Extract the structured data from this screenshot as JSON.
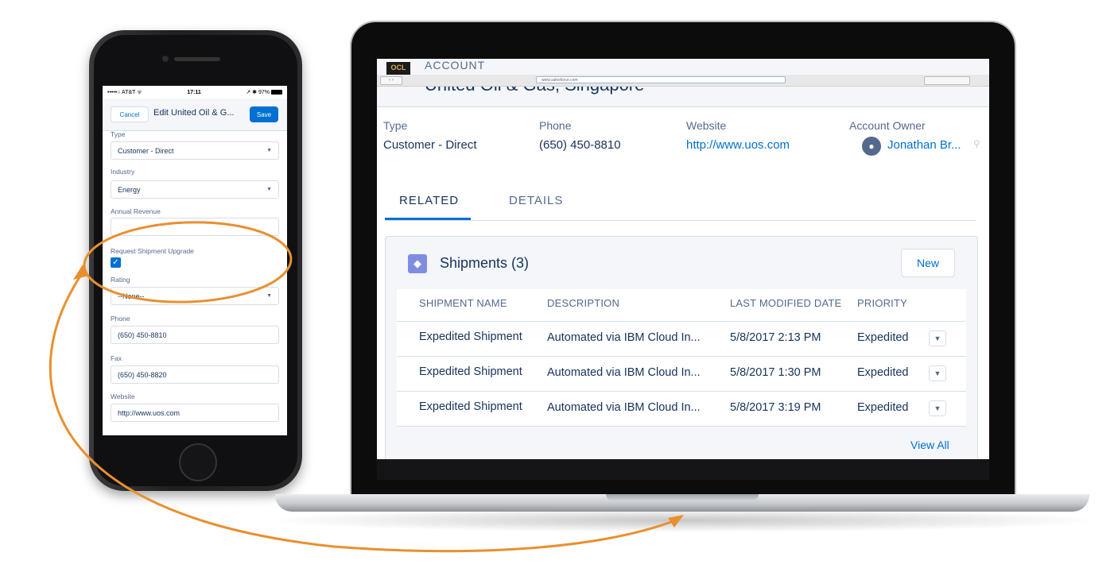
{
  "colors": {
    "link": "#0070d2",
    "text": "#16325c",
    "muted": "#54698d",
    "accent_arrow": "#e8902f",
    "card_icon": "#7f8de1"
  },
  "phone": {
    "status": {
      "carrier": "•••••○ AT&T ᯤ",
      "time": "17:11",
      "battery": "↗ ✱ 97%"
    },
    "header": {
      "cancel": "Cancel",
      "title": "Edit United Oil & G...",
      "save": "Save"
    },
    "fields": {
      "type_label": "Type",
      "type_value": "Customer - Direct",
      "industry_label": "Industry",
      "industry_value": "Energy",
      "revenue_label": "Annual Revenue",
      "upgrade_label": "Request Shipment Upgrade",
      "rating_label": "Rating",
      "rating_value": "--None--",
      "phone_label": "Phone",
      "phone_value": "(650) 450-8810",
      "fax_label": "Fax",
      "fax_value": "(650) 450-8820",
      "website_label": "Website",
      "website_value": "http://www.uos.com"
    }
  },
  "laptop": {
    "browser": {
      "url": "www.salesforce.com"
    },
    "header": {
      "icon_text": "OCL",
      "object_label": "ACCOUNT",
      "record_name": "United Oil & Gas, Singapore"
    },
    "highlights": [
      {
        "label": "Type",
        "value": "Customer - Direct"
      },
      {
        "label": "Phone",
        "value": "(650) 450-8810"
      },
      {
        "label": "Website",
        "value": "http://www.uos.com"
      },
      {
        "label": "Account Owner",
        "value": "Jonathan Br..."
      }
    ],
    "tabs": {
      "related": "RELATED",
      "details": "DETAILS"
    },
    "related_list": {
      "title": "Shipments (3)",
      "new_button": "New",
      "columns": [
        "SHIPMENT NAME",
        "DESCRIPTION",
        "LAST MODIFIED DATE",
        "PRIORITY"
      ],
      "rows": [
        {
          "name": "Expedited Shipment",
          "description": "Automated via IBM Cloud In...",
          "modified": "5/8/2017 2:13 PM",
          "priority": "Expedited"
        },
        {
          "name": "Expedited Shipment",
          "description": "Automated via IBM Cloud In...",
          "modified": "5/8/2017 1:30 PM",
          "priority": "Expedited"
        },
        {
          "name": "Expedited Shipment",
          "description": "Automated via IBM Cloud In...",
          "modified": "5/8/2017 3:19 PM",
          "priority": "Expedited"
        }
      ],
      "view_all": "View All"
    }
  }
}
